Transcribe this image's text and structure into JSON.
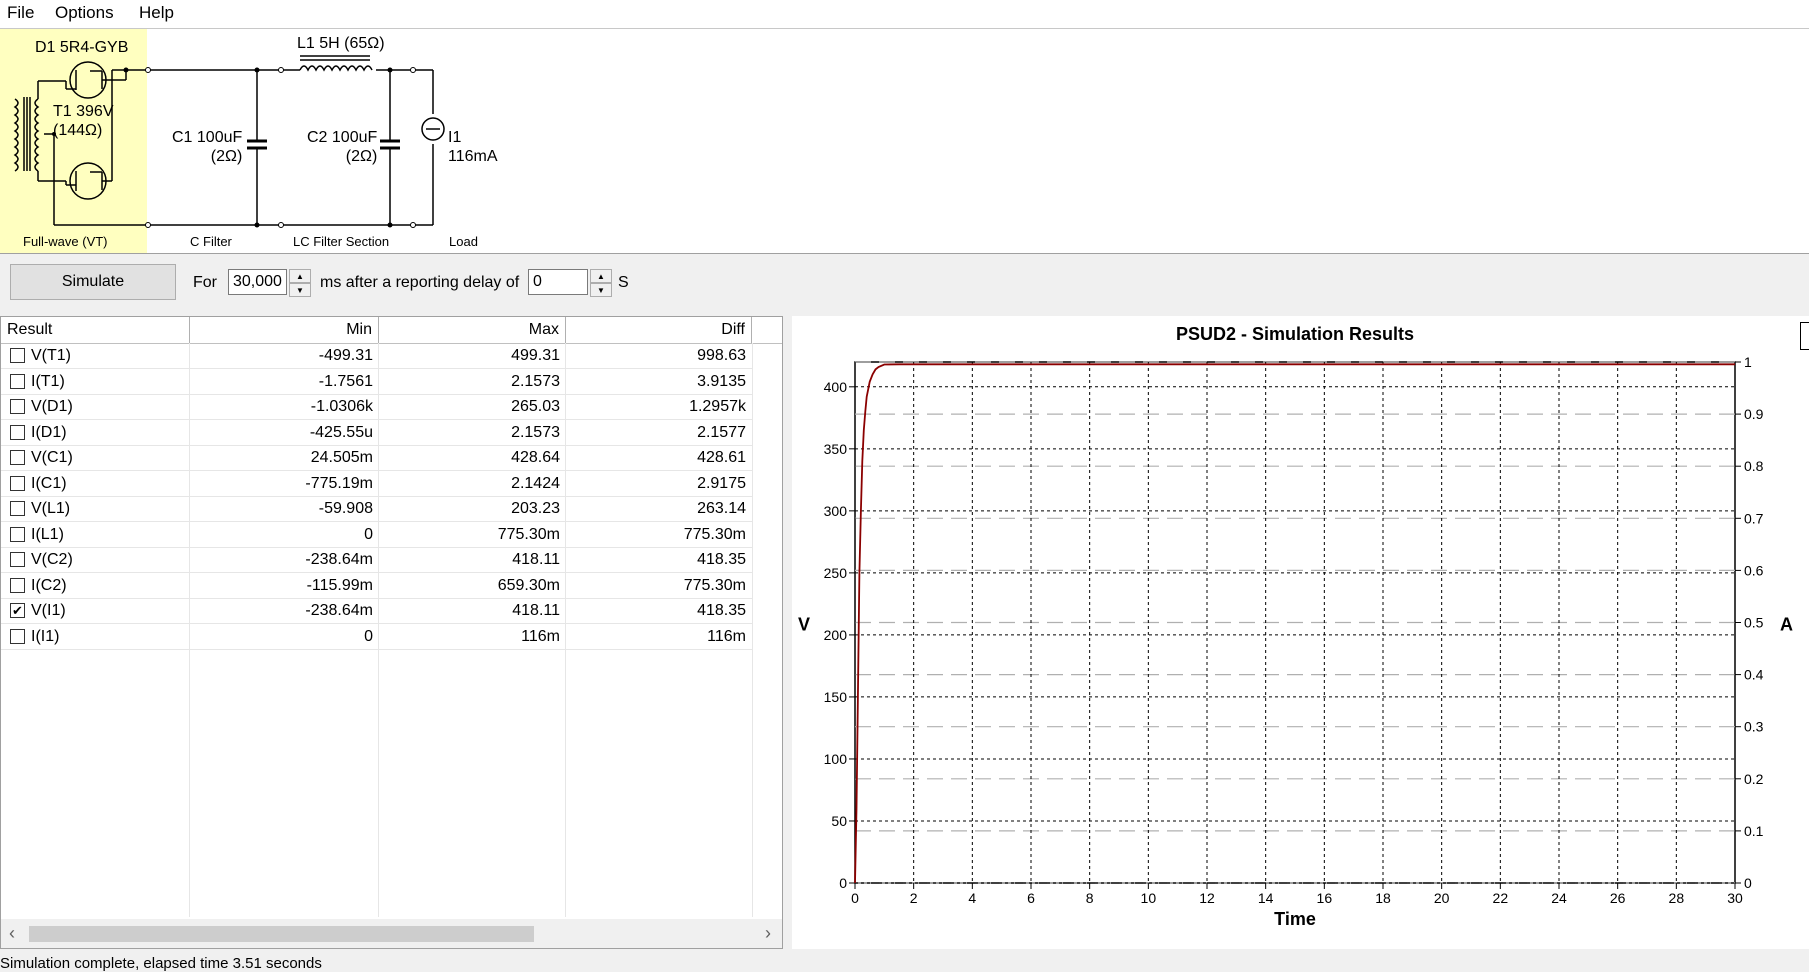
{
  "menu": [
    "File",
    "Options",
    "Help"
  ],
  "circuit": {
    "rectifier_labels": {
      "diode": "D1 5R4-GYB",
      "transformer": "T1 396V\n(144Ω)",
      "section": "Full-wave (VT)"
    },
    "c_filter": {
      "component": "C1 100uF\n(2Ω)",
      "section": "C Filter"
    },
    "lc_filter": {
      "inductor": "L1 5H (65Ω)",
      "capacitor": "C2 100uF\n(2Ω)",
      "section": "LC Filter Section"
    },
    "load": {
      "component": "I1\n116mA",
      "section": "Load"
    }
  },
  "controls": {
    "simulate_label": "Simulate",
    "for_label": "For",
    "duration_value": "30,000",
    "ms_label": "ms  after a reporting delay of",
    "delay_value": "0",
    "s_label": "S"
  },
  "table": {
    "headers": [
      "Result",
      "Min",
      "Max",
      "Diff"
    ],
    "rows": [
      {
        "name": "V(T1)",
        "checked": false,
        "min": "-499.31",
        "max": "499.31",
        "diff": "998.63"
      },
      {
        "name": "I(T1)",
        "checked": false,
        "min": "-1.7561",
        "max": "2.1573",
        "diff": "3.9135"
      },
      {
        "name": "V(D1)",
        "checked": false,
        "min": "-1.0306k",
        "max": "265.03",
        "diff": "1.2957k"
      },
      {
        "name": "I(D1)",
        "checked": false,
        "min": "-425.55u",
        "max": "2.1573",
        "diff": "2.1577"
      },
      {
        "name": "V(C1)",
        "checked": false,
        "min": "24.505m",
        "max": "428.64",
        "diff": "428.61"
      },
      {
        "name": "I(C1)",
        "checked": false,
        "min": "-775.19m",
        "max": "2.1424",
        "diff": "2.9175"
      },
      {
        "name": "V(L1)",
        "checked": false,
        "min": "-59.908",
        "max": "203.23",
        "diff": "263.14"
      },
      {
        "name": "I(L1)",
        "checked": false,
        "min": "0",
        "max": "775.30m",
        "diff": "775.30m"
      },
      {
        "name": "V(C2)",
        "checked": false,
        "min": "-238.64m",
        "max": "418.11",
        "diff": "418.35"
      },
      {
        "name": "I(C2)",
        "checked": false,
        "min": "-115.99m",
        "max": "659.30m",
        "diff": "775.30m"
      },
      {
        "name": "V(I1)",
        "checked": true,
        "min": "-238.64m",
        "max": "418.11",
        "diff": "418.35"
      },
      {
        "name": "I(I1)",
        "checked": false,
        "min": "0",
        "max": "116m",
        "diff": "116m"
      }
    ]
  },
  "chart_data": {
    "type": "line",
    "title": "PSUD2 - Simulation Results",
    "xlabel": "Time",
    "ylabel": "V",
    "y2label": "A",
    "xlim": [
      0,
      30
    ],
    "ylim": [
      0,
      420
    ],
    "y2lim": [
      0,
      1
    ],
    "xticks": [
      0,
      2,
      4,
      6,
      8,
      10,
      12,
      14,
      16,
      18,
      20,
      22,
      24,
      26,
      28,
      30
    ],
    "yticks": [
      0,
      50,
      100,
      150,
      200,
      250,
      300,
      350,
      400
    ],
    "y2ticks": [
      "0",
      "0.1",
      "0.2",
      "0.3",
      "0.4",
      "0.5",
      "0.6",
      "0.7",
      "0.8",
      "0.9",
      "1"
    ],
    "grid": true,
    "series": [
      {
        "color": "#8b0000",
        "x": [
          0,
          0.05,
          0.1,
          0.15,
          0.2,
          0.25,
          0.3,
          0.35,
          0.4,
          0.45,
          0.5,
          0.6,
          0.7,
          0.8,
          1.0,
          1.5,
          30
        ],
        "values": [
          0,
          60,
          150,
          250,
          300,
          340,
          365,
          380,
          392,
          398,
          404,
          410,
          414,
          416,
          418,
          418.11,
          418.11
        ]
      }
    ]
  },
  "status": "Simulation complete, elapsed time 3.51 seconds"
}
